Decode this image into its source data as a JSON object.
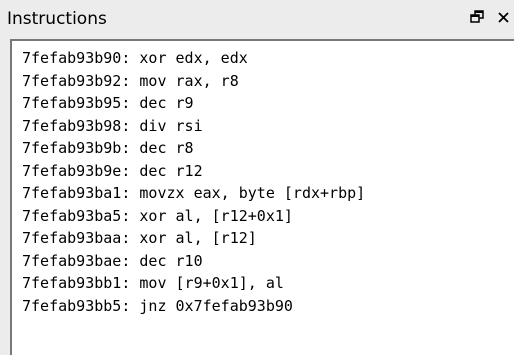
{
  "window": {
    "title": "Instructions",
    "restore_icon": "restore-window-icon",
    "close_icon": "close-icon"
  },
  "instructions": [
    "7fefab93b90: xor edx, edx",
    "7fefab93b92: mov rax, r8",
    "7fefab93b95: dec r9",
    "7fefab93b98: div rsi",
    "7fefab93b9b: dec r8",
    "7fefab93b9e: dec r12",
    "7fefab93ba1: movzx eax, byte [rdx+rbp]",
    "7fefab93ba5: xor al, [r12+0x1]",
    "7fefab93baa: xor al, [r12]",
    "7fefab93bae: dec r10",
    "7fefab93bb1: mov [r9+0x1], al",
    "7fefab93bb5: jnz 0x7fefab93b90"
  ]
}
